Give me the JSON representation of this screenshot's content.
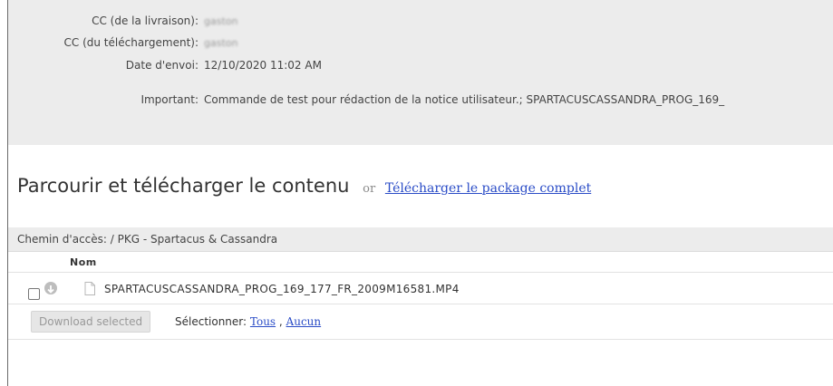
{
  "details": {
    "cc_delivery_label": "CC (de la livraison):",
    "cc_delivery_value": "gaston",
    "cc_download_label": "CC (du téléchargement):",
    "cc_download_value": "gaston",
    "sent_date_label": "Date d'envoi:",
    "sent_date_value": "12/10/2020 11:02 AM",
    "important_label": "Important:",
    "important_value": "Commande de test pour rédaction de la notice utilisateur.; SPARTACUSCASSANDRA_PROG_169_"
  },
  "browse": {
    "title": "Parcourir et télécharger le contenu",
    "or": "or",
    "full_package_link": "Télécharger le package complet"
  },
  "path": {
    "text": "Chemin d'accès: / PKG - Spartacus & Cassandra"
  },
  "table": {
    "column_name": "Nom",
    "files": [
      {
        "name": "SPARTACUSCASSANDRA_PROG_169_177_FR_2009M16581.MP4",
        "icon": "download-icon"
      }
    ]
  },
  "actions": {
    "download_selected": "Download selected",
    "select_label": "Sélectionner:",
    "select_all": "Tous",
    "select_none": "Aucun"
  },
  "colors": {
    "info_bg": "#ececec",
    "link": "#2a4cc7"
  }
}
